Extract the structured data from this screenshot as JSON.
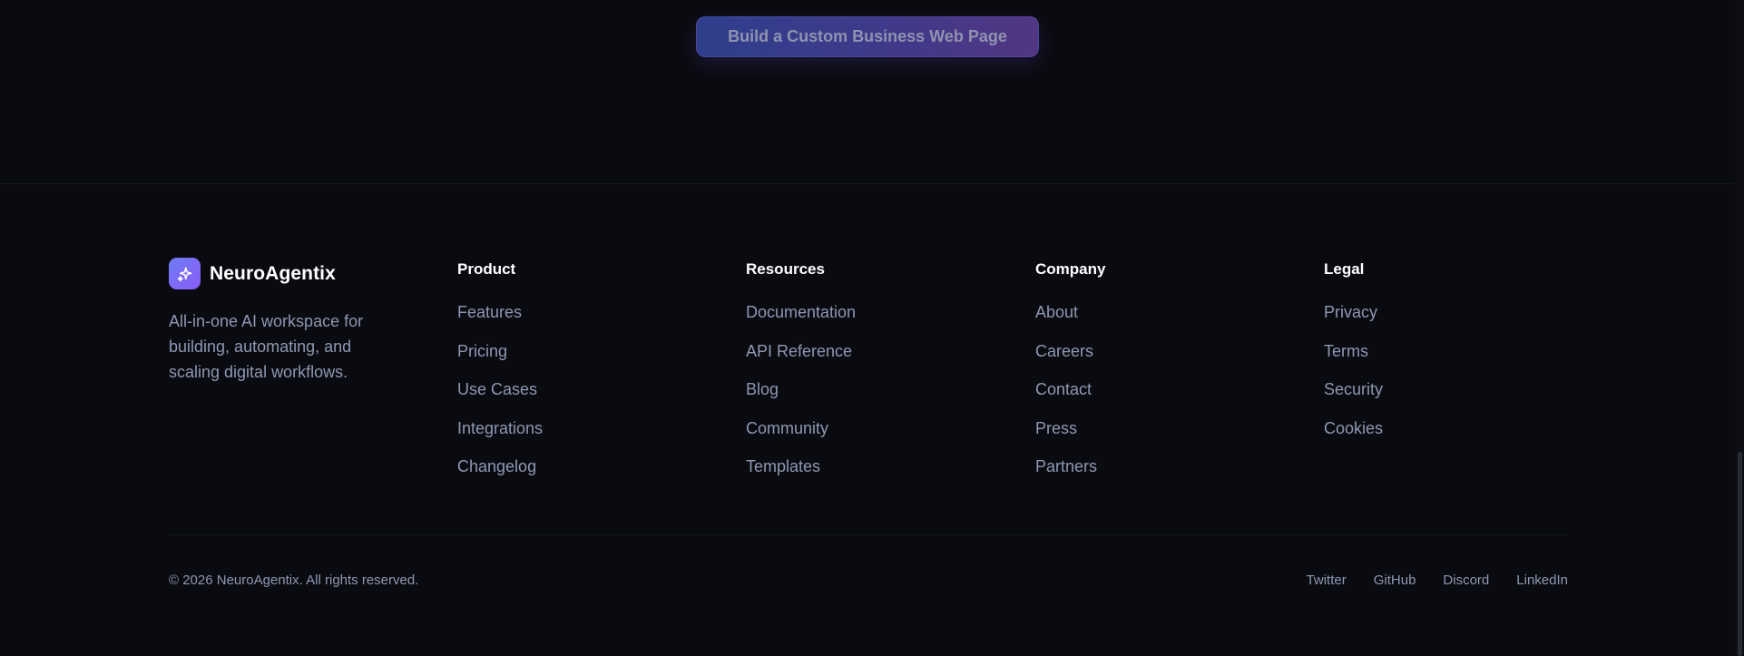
{
  "cta": {
    "label": "Build a Custom Business Web Page"
  },
  "brand": {
    "name": "NeuroAgentix",
    "description": "All-in-one AI workspace for building, automating, and scaling digital workflows."
  },
  "columns": [
    {
      "title": "Product",
      "links": [
        "Features",
        "Pricing",
        "Use Cases",
        "Integrations",
        "Changelog"
      ]
    },
    {
      "title": "Resources",
      "links": [
        "Documentation",
        "API Reference",
        "Blog",
        "Community",
        "Templates"
      ]
    },
    {
      "title": "Company",
      "links": [
        "About",
        "Careers",
        "Contact",
        "Press",
        "Partners"
      ]
    },
    {
      "title": "Legal",
      "links": [
        "Privacy",
        "Terms",
        "Security",
        "Cookies"
      ]
    }
  ],
  "footer": {
    "copyright": "© 2026 NeuroAgentix. All rights reserved.",
    "social": [
      "Twitter",
      "GitHub",
      "Discord",
      "LinkedIn"
    ]
  },
  "icons": {
    "brand_logo": "sparkle-icon"
  },
  "colors": {
    "background": "#0a0b10",
    "text_muted": "#8e98b3",
    "accent_start": "#6d7cf5",
    "accent_end": "#8b5cf6"
  }
}
